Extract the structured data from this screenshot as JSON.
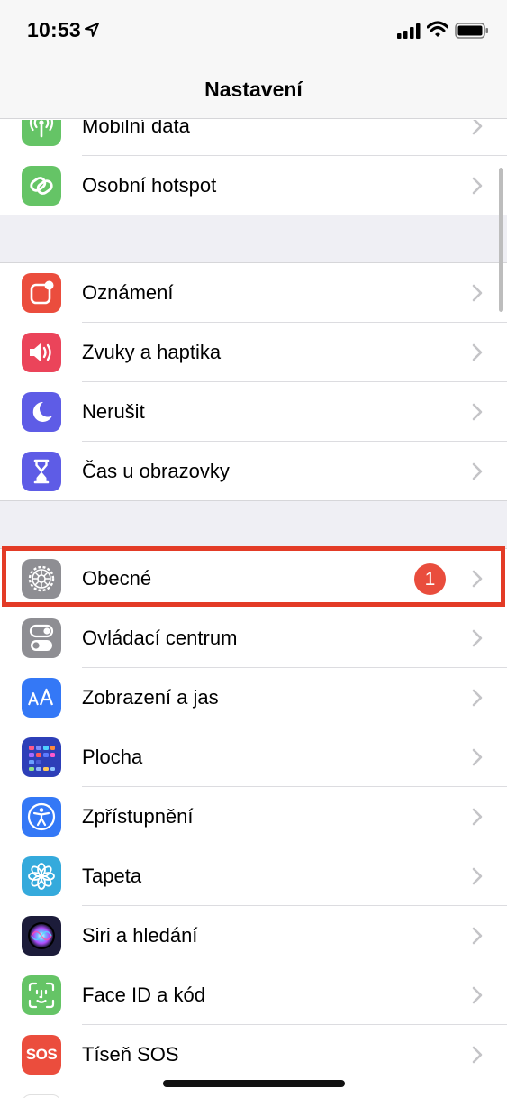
{
  "status_bar": {
    "time": "10:53",
    "icons": [
      "location-arrow-icon",
      "cellular-signal-icon",
      "wifi-icon",
      "battery-icon"
    ]
  },
  "nav": {
    "title": "Nastavení"
  },
  "groups": [
    {
      "items": [
        {
          "label": "Mobilní data",
          "icon": "antenna-icon",
          "color": "#65c466"
        },
        {
          "label": "Osobní hotspot",
          "icon": "hotspot-chain-icon",
          "color": "#65c466"
        }
      ]
    },
    {
      "items": [
        {
          "label": "Oznámení",
          "icon": "notifications-icon",
          "color": "#eb4d3d"
        },
        {
          "label": "Zvuky a haptika",
          "icon": "speaker-icon",
          "color": "#eb445a"
        },
        {
          "label": "Nerušit",
          "icon": "moon-icon",
          "color": "#5e5ce6"
        },
        {
          "label": "Čas u obrazovky",
          "icon": "hourglass-icon",
          "color": "#5e5ce6"
        }
      ]
    },
    {
      "items": [
        {
          "label": "Obecné",
          "icon": "gear-icon",
          "color": "#8e8e93",
          "badge": "1",
          "highlighted": true
        },
        {
          "label": "Ovládací centrum",
          "icon": "toggles-icon",
          "color": "#8e8e93"
        },
        {
          "label": "Zobrazení a jas",
          "icon": "text-size-icon",
          "color": "#3478f6"
        },
        {
          "label": "Plocha",
          "icon": "home-screen-grid-icon",
          "color": "#2d3fb8"
        },
        {
          "label": "Zpřístupnění",
          "icon": "accessibility-icon",
          "color": "#3478f6"
        },
        {
          "label": "Tapeta",
          "icon": "flower-icon",
          "color": "#35aadc"
        },
        {
          "label": "Siri a hledání",
          "icon": "siri-icon",
          "color": "#1c1c3a"
        },
        {
          "label": "Face ID a kód",
          "icon": "face-id-icon",
          "color": "#65c466"
        },
        {
          "label": "Tíseň SOS",
          "icon": "sos-icon",
          "color": "#eb4d3d",
          "icon_text": "SOS"
        }
      ]
    }
  ]
}
